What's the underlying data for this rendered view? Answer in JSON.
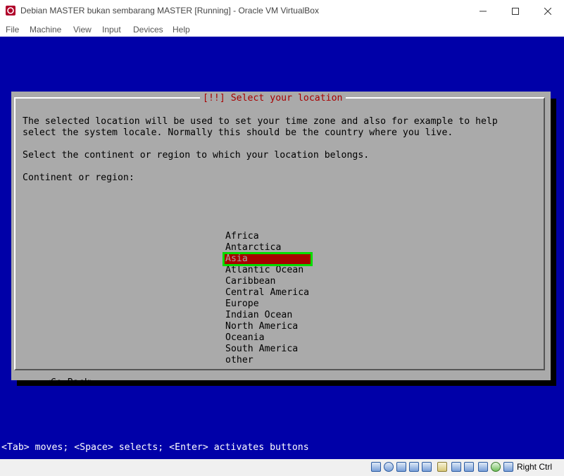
{
  "window": {
    "title": "Debian MASTER bukan sembarang MASTER [Running] - Oracle VM VirtualBox",
    "minimize_icon": "minimize-icon",
    "maximize_icon": "maximize-icon",
    "close_icon": "close-icon"
  },
  "menu": [
    "File",
    "Machine",
    "View",
    "Input",
    "Devices",
    "Help"
  ],
  "dialog": {
    "title": "[!!] Select your location",
    "line1": "The selected location will be used to set your time zone and also for example to help",
    "line2": "select the system locale. Normally this should be the country where you live.",
    "prompt": "Select the continent or region to which your location belongs.",
    "field_label": "Continent or region:",
    "options": [
      "Africa",
      "Antarctica",
      "Asia",
      "Atlantic Ocean",
      "Caribbean",
      "Central America",
      "Europe",
      "Indian Ocean",
      "North America",
      "Oceania",
      "South America",
      "other"
    ],
    "selected_option": "Asia",
    "back_button": "<Go Back>"
  },
  "hint": "<Tab> moves; <Space> selects; <Enter> activates buttons",
  "statusbar": {
    "host_key": "Right Ctrl",
    "icons": [
      "hard-disk-icon",
      "optical-drive-icon",
      "audio-icon",
      "network-icon",
      "usb-icon",
      "shared-folders-icon",
      "display-icon",
      "recording-icon",
      "cpu-icon",
      "mouse-integration-icon",
      "keyboard-icon"
    ]
  },
  "colors": {
    "vm_background": "#0000a8",
    "dialog": "#aaaaaa",
    "title_text": "#a80000",
    "selection": "#a80000",
    "focus_outline": "#00dd00"
  }
}
